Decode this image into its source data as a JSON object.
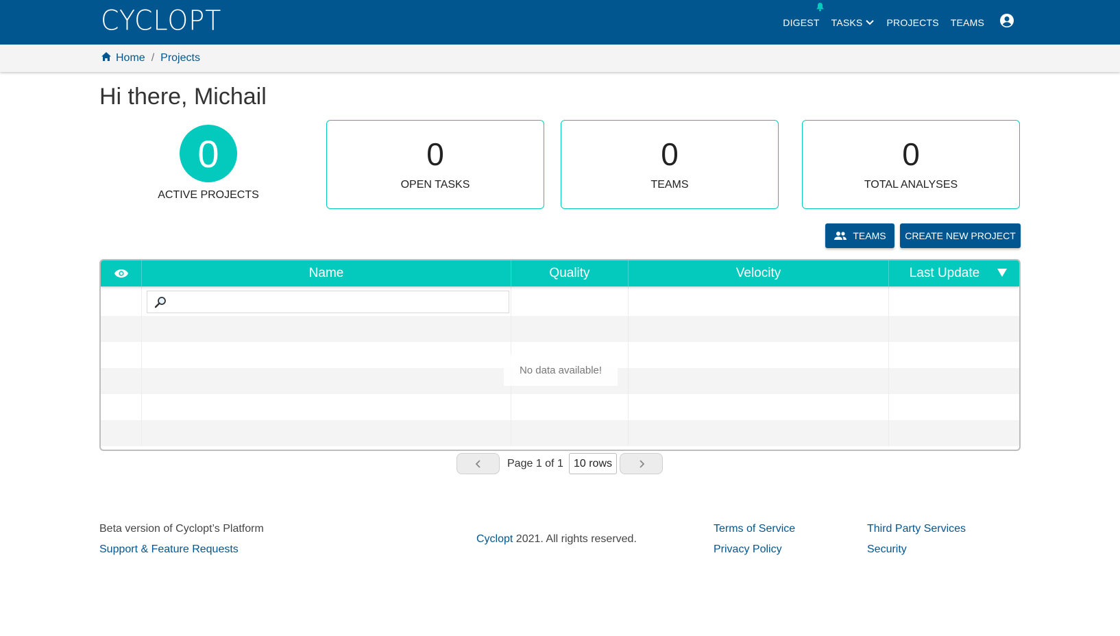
{
  "app": {
    "logo": "CYCLOPT"
  },
  "nav": {
    "items": [
      {
        "label": "DIGEST"
      },
      {
        "label": "TASKS"
      },
      {
        "label": "PROJECTS"
      },
      {
        "label": "TEAMS"
      }
    ]
  },
  "breadcrumb": {
    "home": "Home",
    "separator": "/",
    "current": "Projects"
  },
  "greeting": "Hi there, Michail",
  "stats": {
    "active_projects": {
      "value": "0",
      "label": "ACTIVE PROJECTS"
    },
    "open_tasks": {
      "value": "0",
      "label": "OPEN TASKS"
    },
    "teams": {
      "value": "0",
      "label": "TEAMS"
    },
    "total_analyses": {
      "value": "0",
      "label": "TOTAL ANALYSES"
    }
  },
  "actions": {
    "teams_button": "TEAMS",
    "create_button": "CREATE NEW PROJECT"
  },
  "table": {
    "columns": [
      "Name",
      "Quality",
      "Velocity",
      "Last Update"
    ],
    "search_placeholder": "",
    "empty_message": "No data available!"
  },
  "pagination": {
    "page_text": "Page 1 of 1",
    "rows_select": "10 rows"
  },
  "footer": {
    "beta": "Beta version of Cyclopt’s Platform",
    "support": "Support & Feature Requests",
    "copyright_brand": "Cyclopt",
    "copyright_rest": " 2021. All rights reserved.",
    "terms": "Terms of Service",
    "privacy": "Privacy Policy",
    "third_party": "Third Party Services",
    "security": "Security"
  },
  "colors": {
    "primary": "#02568f",
    "accent": "#04c9bd"
  }
}
